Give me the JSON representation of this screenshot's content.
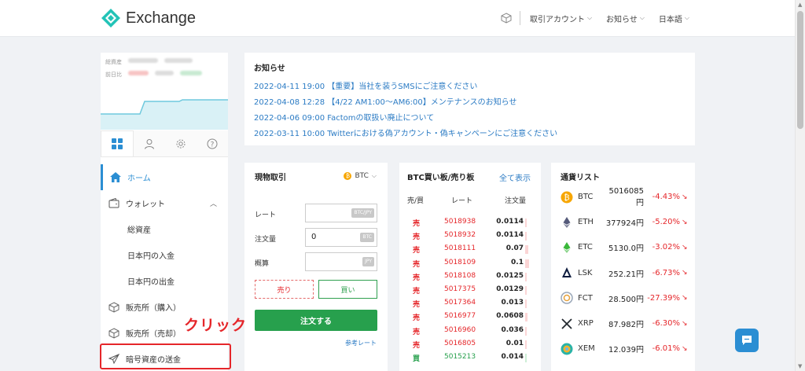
{
  "app": {
    "name": "Exchange"
  },
  "header": {
    "nav": [
      {
        "label": "取引アカウント"
      },
      {
        "label": "お知らせ"
      },
      {
        "label": "日本語"
      }
    ]
  },
  "sidebar": {
    "mini": {
      "label1": "総資産",
      "label2": "前日比"
    },
    "menu": [
      {
        "label": "ホーム"
      },
      {
        "label": "ウォレット"
      },
      {
        "label": "総資産"
      },
      {
        "label": "日本円の入金"
      },
      {
        "label": "日本円の出金"
      },
      {
        "label": "販売所（購入）"
      },
      {
        "label": "販売所（売却）"
      },
      {
        "label": "暗号資産の送金"
      }
    ]
  },
  "annotation": {
    "text": "クリック",
    "color": "#e5262a"
  },
  "news": {
    "title": "お知らせ",
    "items": [
      {
        "text": "2022-04-11 19:00 【重要】当社を装うSMSにご注意ください"
      },
      {
        "text": "2022-04-08 12:28 【4/22 AM1:00〜AM6:00】メンテナンスのお知らせ"
      },
      {
        "text": "2022-04-06 09:00 Factomの取扱い廃止について"
      },
      {
        "text": "2022-03-11 10:00 Twitterにおける偽アカウント・偽キャンペーンにご注意ください"
      }
    ]
  },
  "spot": {
    "title": "現物取引",
    "coin": "BTC",
    "rate_label": "レート",
    "rate_unit": "BTC/JPY",
    "qty_label": "注文量",
    "qty_value": "0",
    "qty_unit": "BTC",
    "est_label": "概算",
    "est_unit": "JPY",
    "sell": "売り",
    "buy": "買い",
    "order": "注文する",
    "ref": "参考レート"
  },
  "book": {
    "title": "BTC買い板/売り板",
    "all": "全て表示",
    "h_side": "売/買",
    "h_rate": "レート",
    "h_qty": "注文量",
    "rows": [
      {
        "side": "売",
        "price": "5018938",
        "qty": "0.0114",
        "kind": "ask",
        "depth": 0.05
      },
      {
        "side": "売",
        "price": "5018932",
        "qty": "0.0114",
        "kind": "ask",
        "depth": 0.05
      },
      {
        "side": "売",
        "price": "5018111",
        "qty": "0.07",
        "kind": "ask",
        "depth": 0.3
      },
      {
        "side": "売",
        "price": "5018109",
        "qty": "0.1",
        "kind": "ask",
        "depth": 0.4
      },
      {
        "side": "売",
        "price": "5018108",
        "qty": "0.0125",
        "kind": "ask",
        "depth": 0.05
      },
      {
        "side": "売",
        "price": "5017375",
        "qty": "0.0129",
        "kind": "ask",
        "depth": 0.05
      },
      {
        "side": "売",
        "price": "5017364",
        "qty": "0.013",
        "kind": "ask",
        "depth": 0.05
      },
      {
        "side": "売",
        "price": "5016977",
        "qty": "0.0608",
        "kind": "ask",
        "depth": 0.25
      },
      {
        "side": "売",
        "price": "5016960",
        "qty": "0.036",
        "kind": "ask",
        "depth": 0.15
      },
      {
        "side": "売",
        "price": "5016805",
        "qty": "0.01",
        "kind": "ask",
        "depth": 0.05
      },
      {
        "side": "買",
        "price": "5015213",
        "qty": "0.014",
        "kind": "bid",
        "depth": 0.05
      }
    ]
  },
  "coins": {
    "title": "通貨リスト",
    "items": [
      {
        "sym": "BTC",
        "price": "5016085円",
        "change": "-4.43%",
        "icon": "btc-icon",
        "color": "#f7a600"
      },
      {
        "sym": "ETH",
        "price": "377924円",
        "change": "-5.20%",
        "icon": "eth-icon",
        "color": "#555a7a"
      },
      {
        "sym": "ETC",
        "price": "5130.0円",
        "change": "-3.02%",
        "icon": "etc-icon",
        "color": "#3ab83a"
      },
      {
        "sym": "LSK",
        "price": "252.21円",
        "change": "-6.73%",
        "icon": "lsk-icon",
        "color": "#0d1c3f"
      },
      {
        "sym": "FCT",
        "price": "28.500円",
        "change": "-27.39%",
        "icon": "fct-icon",
        "color": "#9aa7b8"
      },
      {
        "sym": "XRP",
        "price": "87.982円",
        "change": "-6.30%",
        "icon": "xrp-icon",
        "color": "#23292f"
      },
      {
        "sym": "XEM",
        "price": "12.039円",
        "change": "-6.01%",
        "icon": "xem-icon",
        "color": "#2ab3a8"
      }
    ]
  }
}
